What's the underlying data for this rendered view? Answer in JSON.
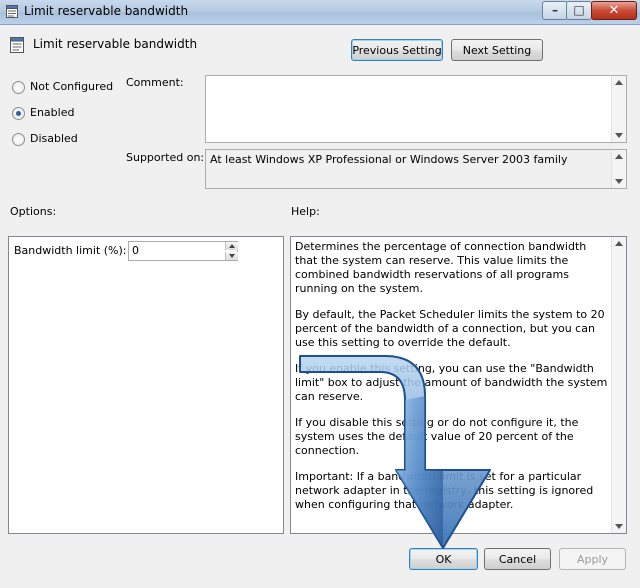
{
  "window": {
    "title": "Limit reservable bandwidth",
    "controls": {
      "minimize": "–",
      "maximize": "□",
      "close": "✕"
    }
  },
  "header": {
    "setting_title": "Limit reservable bandwidth",
    "previous_label": "Previous Setting",
    "next_label": "Next Setting"
  },
  "state": {
    "options": [
      {
        "label": "Not Configured",
        "selected": false
      },
      {
        "label": "Enabled",
        "selected": true
      },
      {
        "label": "Disabled",
        "selected": false
      }
    ]
  },
  "comment": {
    "label": "Comment:",
    "value": ""
  },
  "supported": {
    "label": "Supported on:",
    "value": "At least Windows XP Professional or Windows Server 2003 family"
  },
  "options_panel": {
    "label": "Options:",
    "bandwidth_label": "Bandwidth limit (%):",
    "bandwidth_value": "0"
  },
  "help_panel": {
    "label": "Help:",
    "paragraphs": [
      "Determines the percentage of connection bandwidth that the system can reserve. This value limits the combined bandwidth reservations of all programs running on the system.",
      "By default, the Packet Scheduler limits the system to 20 percent of the bandwidth of a connection, but you can use this setting to override the default.",
      "If you enable this setting, you can use the \"Bandwidth limit\" box to adjust the amount of bandwidth the system can reserve.",
      "If you disable this setting or do not configure it, the system uses the default value of 20 percent of the connection.",
      "Important: If a bandwidth limit is set for a particular network adapter in the registry, this setting is ignored when configuring that network adapter."
    ]
  },
  "footer": {
    "ok_label": "OK",
    "cancel_label": "Cancel",
    "apply_label": "Apply"
  },
  "colors": {
    "arrow_fill": "#4f88c9",
    "arrow_edge": "#1f4f8f",
    "title_bar": "#b5cae2"
  },
  "icons": {
    "title_icon": "policy-setting-icon",
    "setting_icon": "policy-setting-icon",
    "overlay": "bent-down-arrow"
  }
}
